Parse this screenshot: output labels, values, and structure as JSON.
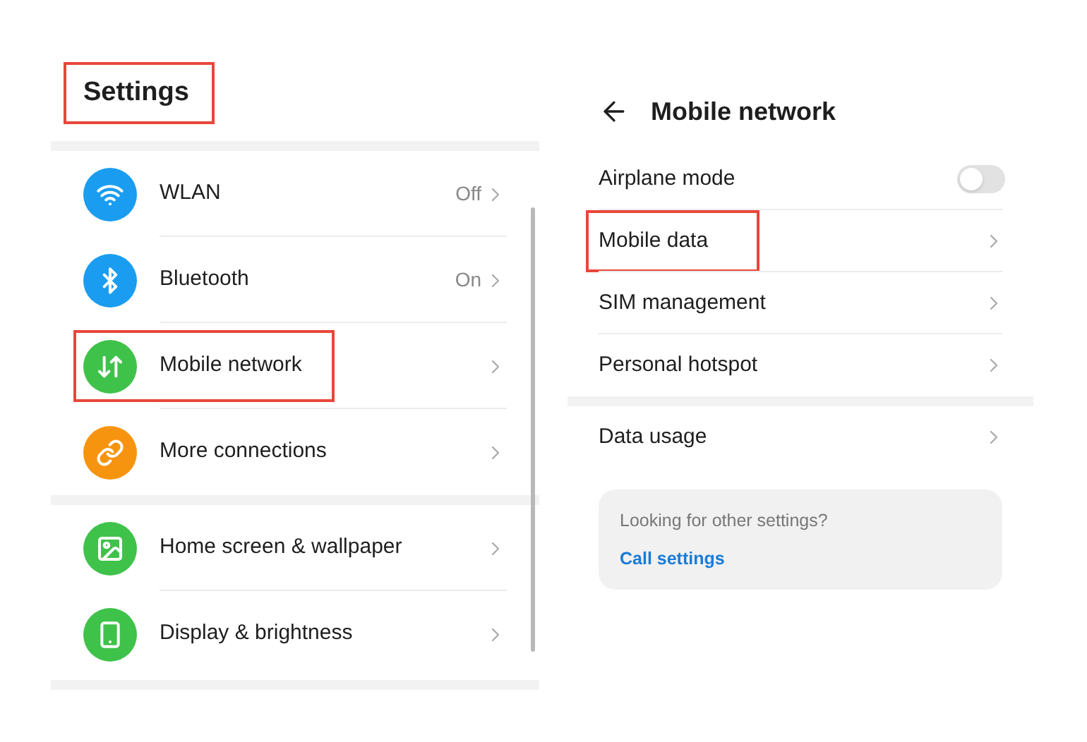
{
  "settings": {
    "title": "Settings",
    "title_highlighted": true,
    "groups": [
      {
        "items": [
          {
            "color": "#1a9df0",
            "label": "WLAN",
            "value": "Off",
            "highlighted": false
          },
          {
            "color": "#1a9df0",
            "label": "Bluetooth",
            "value": "On",
            "highlighted": false
          },
          {
            "color": "#3fc24a",
            "label": "Mobile network",
            "highlighted": true
          },
          {
            "color": "#f7940f",
            "label": "More connections",
            "highlighted": false
          }
        ]
      },
      {
        "items": [
          {
            "color": "#3fc24a",
            "label": "Home screen & wallpaper",
            "highlighted": false
          },
          {
            "color": "#3fc24a",
            "label": "Display & brightness",
            "highlighted": false
          }
        ]
      }
    ]
  },
  "mobile_network": {
    "title": "Mobile network",
    "groups": [
      {
        "items": [
          {
            "kind": "toggle",
            "label": "Airplane mode",
            "on": false,
            "highlighted": false
          },
          {
            "kind": "chevron",
            "label": "Mobile data",
            "highlighted": true
          },
          {
            "kind": "chevron",
            "label": "SIM management",
            "highlighted": false
          },
          {
            "kind": "chevron",
            "label": "Personal hotspot",
            "highlighted": false
          }
        ]
      },
      {
        "items": [
          {
            "kind": "chevron",
            "label": "Data usage",
            "highlighted": false
          }
        ]
      }
    ],
    "suggestion": {
      "prompt": "Looking for other settings?",
      "link": "Call settings"
    }
  }
}
